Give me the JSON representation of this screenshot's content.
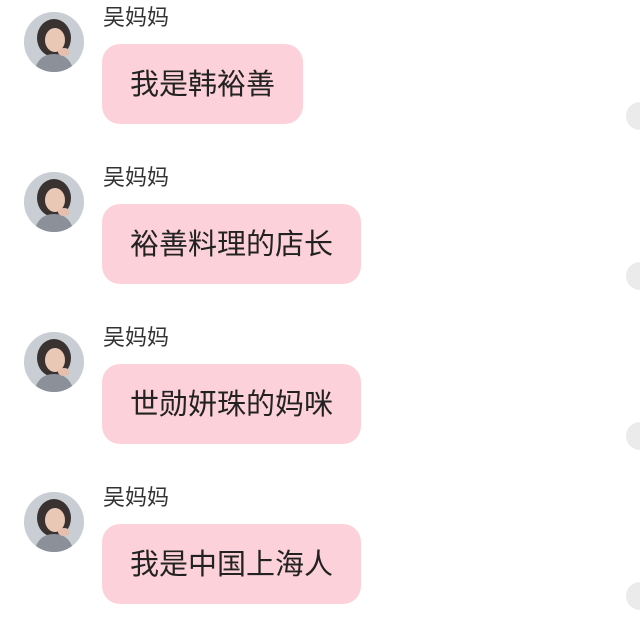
{
  "colors": {
    "bubble": "#fdd1da",
    "background": "#ffffff",
    "text": "#222222"
  },
  "messages": [
    {
      "sender": "吴妈妈",
      "text": "我是韩裕善",
      "avatar_icon": "user-avatar-icon"
    },
    {
      "sender": "吴妈妈",
      "text": "裕善料理的店长",
      "avatar_icon": "user-avatar-icon"
    },
    {
      "sender": "吴妈妈",
      "text": "世勋妍珠的妈咪",
      "avatar_icon": "user-avatar-icon"
    },
    {
      "sender": "吴妈妈",
      "text": "我是中国上海人",
      "avatar_icon": "user-avatar-icon"
    }
  ],
  "partial_next_sender": "",
  "edge_indicator_icon": "circle-indicator-icon"
}
